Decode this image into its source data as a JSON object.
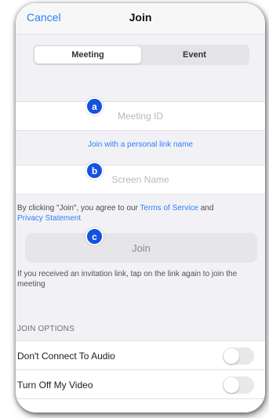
{
  "nav": {
    "cancel_label": "Cancel",
    "title": "Join"
  },
  "tabs": [
    {
      "label": "Meeting",
      "active": true
    },
    {
      "label": "Event",
      "active": false
    }
  ],
  "meeting_id": {
    "placeholder": "Meeting ID",
    "value": ""
  },
  "personal_link_label": "Join with a personal link name",
  "screen_name": {
    "placeholder": "Screen Name",
    "value": ""
  },
  "agreement": {
    "prefix": "By clicking \"Join\", you agree to our ",
    "terms": "Terms of Service",
    "middle": " and",
    "privacy": "Privacy Statement"
  },
  "join_button_label": "Join",
  "invitation_hint": "If you received an invitation link, tap on the link again to join the meeting",
  "join_options": {
    "header": "JOIN OPTIONS",
    "items": [
      {
        "label": "Don't Connect To Audio",
        "on": false
      },
      {
        "label": "Turn Off My Video",
        "on": false
      }
    ]
  },
  "markers": {
    "a": "a",
    "b": "b",
    "c": "c"
  },
  "colors": {
    "accent": "#2d7ff9",
    "marker": "#1453e0",
    "toggle_off": "#e9e9eb"
  }
}
